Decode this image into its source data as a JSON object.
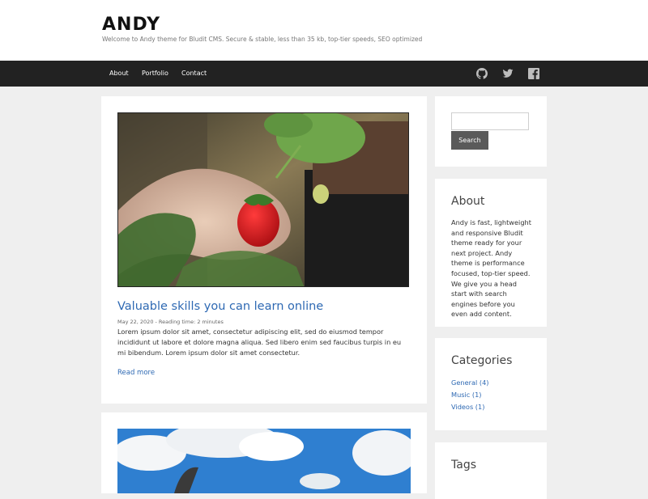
{
  "site": {
    "title": "ANDY",
    "tagline": "Welcome to Andy theme for Bludit CMS. Secure & stable, less than 35 kb, top-tier speeds, SEO optimized"
  },
  "nav": {
    "links": [
      "About",
      "Portfolio",
      "Contact"
    ],
    "social_icons": [
      "github-icon",
      "twitter-icon",
      "facebook-icon"
    ]
  },
  "posts": [
    {
      "title": "Valuable skills you can learn online",
      "meta": "May 22, 2020 - Reading time: 2 minutes",
      "excerpt": "Lorem ipsum dolor sit amet, consectetur adipiscing elit, sed do eiusmod tempor incididunt ut labore et dolore magna aliqua. Sed libero enim sed faucibus turpis in eu mi bibendum. Lorem ipsum dolor sit amet consectetur.",
      "read_more": "Read more"
    }
  ],
  "sidebar": {
    "search": {
      "placeholder": "",
      "button_label": "Search"
    },
    "about": {
      "title": "About",
      "text": "Andy is fast, lightweight and responsive Bludit theme ready for your next project. Andy theme is performance focused, top-tier speed. We give you a head start with search engines before you even add content."
    },
    "categories": {
      "title": "Categories",
      "items": [
        "General (4)",
        "Music (1)",
        "Videos (1)"
      ]
    },
    "tags": {
      "title": "Tags"
    }
  },
  "colors": {
    "navbar": "#222222",
    "link": "#2e69b3",
    "page_background": "#efefef",
    "search_button": "#5a5a5a"
  }
}
